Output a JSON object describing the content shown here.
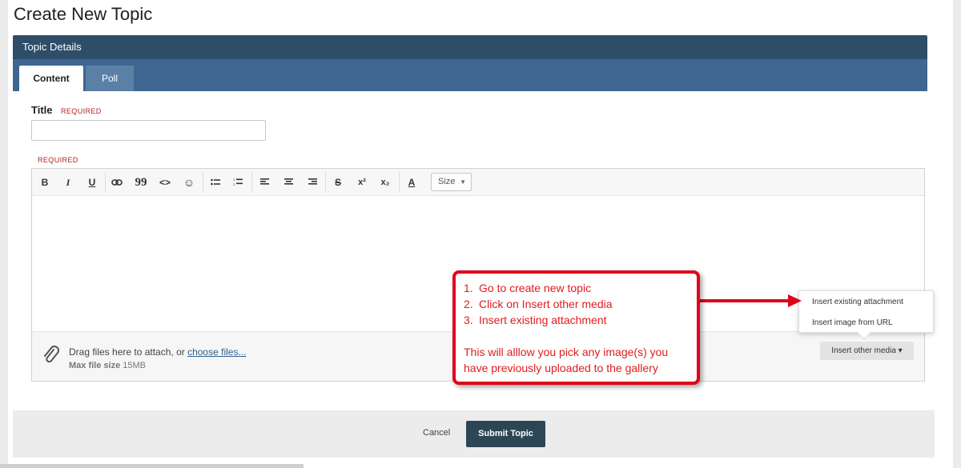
{
  "page": {
    "title": "Create New Topic"
  },
  "panel": {
    "header": "Topic Details"
  },
  "tabs": [
    {
      "label": "Content",
      "active": true
    },
    {
      "label": "Poll",
      "active": false
    }
  ],
  "form": {
    "title_label": "Title",
    "title_required": "REQUIRED",
    "title_value": "",
    "editor_required": "REQUIRED"
  },
  "toolbar": {
    "size_label": "Size",
    "buttons": [
      {
        "name": "bold",
        "glyph": "B"
      },
      {
        "name": "italic",
        "glyph": "I"
      },
      {
        "name": "underline",
        "glyph": "U"
      },
      {
        "name": "link",
        "glyph": "⚭"
      },
      {
        "name": "quote",
        "glyph": "❞"
      },
      {
        "name": "code",
        "glyph": "<>"
      },
      {
        "name": "emoji",
        "glyph": "☺"
      },
      {
        "name": "bulleted-list",
        "glyph": "≔"
      },
      {
        "name": "numbered-list",
        "glyph": "≔"
      },
      {
        "name": "align-left",
        "glyph": "≡"
      },
      {
        "name": "align-center",
        "glyph": "≡"
      },
      {
        "name": "align-right",
        "glyph": "≡"
      },
      {
        "name": "strikethrough",
        "glyph": "S"
      },
      {
        "name": "superscript",
        "glyph": "x²"
      },
      {
        "name": "subscript",
        "glyph": "x₂"
      },
      {
        "name": "font-color",
        "glyph": "A"
      }
    ]
  },
  "attachments": {
    "drag_text": "Drag files here to attach, or ",
    "choose_link": "choose files...",
    "max_label": "Max file size",
    "max_value": "15MB",
    "insert_media_label": "Insert other media ▾"
  },
  "media_menu": {
    "items": [
      "Insert existing attachment",
      "Insert image from URL"
    ]
  },
  "callout": {
    "steps": [
      {
        "num": "1.",
        "text": "Go to create new topic"
      },
      {
        "num": "2.",
        "text": "Click on Insert other media"
      },
      {
        "num": "3.",
        "text": "Insert existing attachment"
      }
    ],
    "note_line1": "This will alllow you pick any image(s) you",
    "note_line2": "have previously uploaded to the gallery",
    "color": "#e01c1c"
  },
  "footer": {
    "cancel_label": "Cancel",
    "submit_label": "Submit Topic"
  },
  "colors": {
    "header": "#2e4d69",
    "tabbar": "#3f6690",
    "submit": "#2d4656"
  }
}
